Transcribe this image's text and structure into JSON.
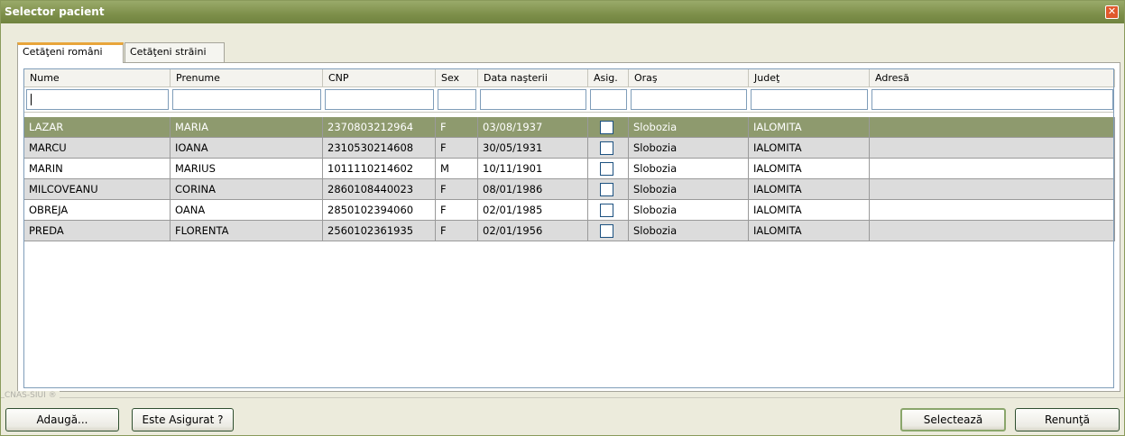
{
  "window": {
    "title": "Selector pacient"
  },
  "tabs": [
    {
      "label": "Cetăţeni români",
      "active": true
    },
    {
      "label": "Cetăţeni străini",
      "active": false
    }
  ],
  "grid": {
    "columns": [
      "Nume",
      "Prenume",
      "CNP",
      "Sex",
      "Data naşterii",
      "Asig.",
      "Oraş",
      "Judeţ",
      "Adresă"
    ],
    "rows": [
      {
        "nume": "LAZAR",
        "prenume": "MARIA",
        "cnp": "2370803212964",
        "sex": "F",
        "data": "03/08/1937",
        "asig": false,
        "oras": "Slobozia",
        "judet": "IALOMITA",
        "adresa": ""
      },
      {
        "nume": "MARCU",
        "prenume": "IOANA",
        "cnp": "2310530214608",
        "sex": "F",
        "data": "30/05/1931",
        "asig": false,
        "oras": "Slobozia",
        "judet": "IALOMITA",
        "adresa": ""
      },
      {
        "nume": "MARIN",
        "prenume": "MARIUS",
        "cnp": "1011110214602",
        "sex": "M",
        "data": "10/11/1901",
        "asig": false,
        "oras": "Slobozia",
        "judet": "IALOMITA",
        "adresa": ""
      },
      {
        "nume": "MILCOVEANU",
        "prenume": "CORINA",
        "cnp": "2860108440023",
        "sex": "F",
        "data": "08/01/1986",
        "asig": false,
        "oras": "Slobozia",
        "judet": "IALOMITA",
        "adresa": ""
      },
      {
        "nume": "OBREJA",
        "prenume": "OANA",
        "cnp": "2850102394060",
        "sex": "F",
        "data": "02/01/1985",
        "asig": false,
        "oras": "Slobozia",
        "judet": "IALOMITA",
        "adresa": ""
      },
      {
        "nume": "PREDA",
        "prenume": "FLORENTA",
        "cnp": "2560102361935",
        "sex": "F",
        "data": "02/01/1956",
        "asig": false,
        "oras": "Slobozia",
        "judet": "IALOMITA",
        "adresa": ""
      }
    ],
    "selected_row": 0
  },
  "footer": {
    "tag": "CNAS-SIUI ®",
    "add_label": "Adaugă...",
    "insured_label": "Este Asigurat ?",
    "select_label": "Selectează",
    "cancel_label": "Renunţă"
  },
  "colors": {
    "title_bar": "#7d8f4a",
    "selected_row": "#8e9a6e",
    "alt_row": "#dcdcdc",
    "active_tab_accent": "#e8a53b"
  },
  "icons": {
    "close": "close-icon",
    "checkbox": "checkbox-icon"
  }
}
